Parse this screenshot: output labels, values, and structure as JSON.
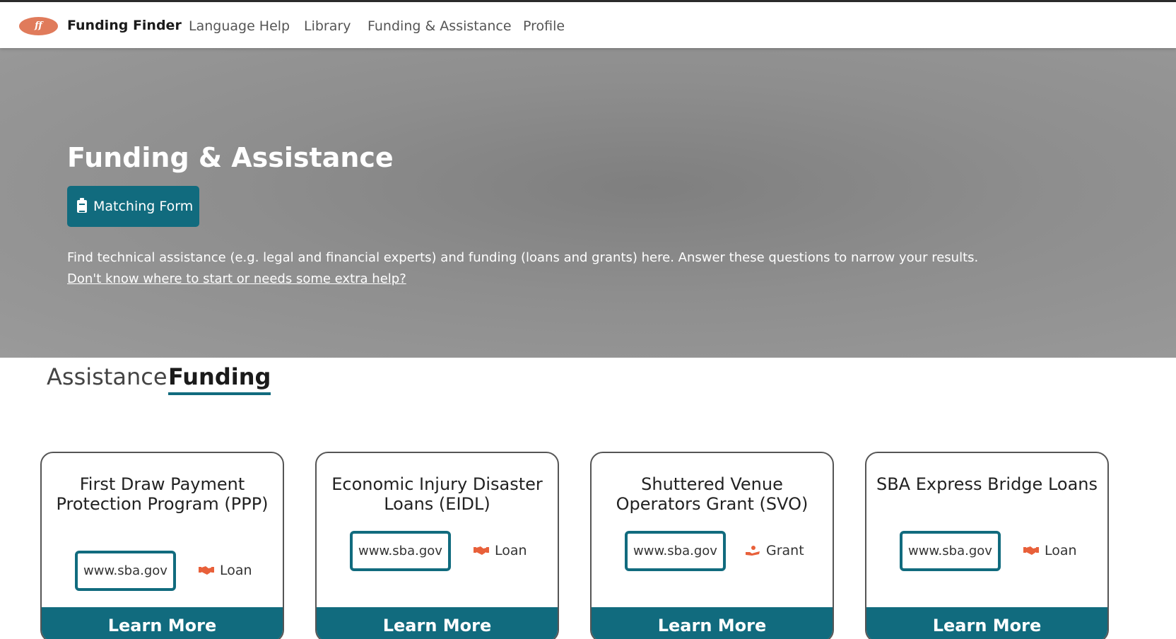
{
  "navbar": {
    "logo_text": "ff",
    "brand": "Funding Finder",
    "links": [
      "Language Help",
      "Library",
      "Funding & Assistance",
      "Profile"
    ]
  },
  "hero": {
    "title": "Funding & Assistance",
    "matching_button": "Matching Form",
    "description": "Find technical assistance (e.g. legal and financial experts) and funding (loans and grants) here. Answer these questions to narrow your results.",
    "help_link": "Don't know where to start or needs some extra help?"
  },
  "tabs": {
    "assistance": "Assistance",
    "funding": "Funding",
    "active": "Funding"
  },
  "cards": [
    {
      "title": "First Draw Payment Protection Program (PPP)",
      "url": "www.sba.gov",
      "type": "Loan",
      "type_icon": "handshake-icon",
      "cta": "Learn More"
    },
    {
      "title": "Economic Injury Disaster Loans (EIDL)",
      "url": "www.sba.gov",
      "type": "Loan",
      "type_icon": "handshake-icon",
      "cta": "Learn More"
    },
    {
      "title": "Shuttered Venue Operators Grant (SVO)",
      "url": "www.sba.gov",
      "type": "Grant",
      "type_icon": "hand-holding-icon",
      "cta": "Learn More"
    },
    {
      "title": "SBA Express Bridge Loans",
      "url": "www.sba.gov",
      "type": "Loan",
      "type_icon": "handshake-icon",
      "cta": "Learn More"
    }
  ],
  "colors": {
    "accent": "#116b7e",
    "icon_orange": "#e8603a",
    "logo": "#e07b5b"
  }
}
